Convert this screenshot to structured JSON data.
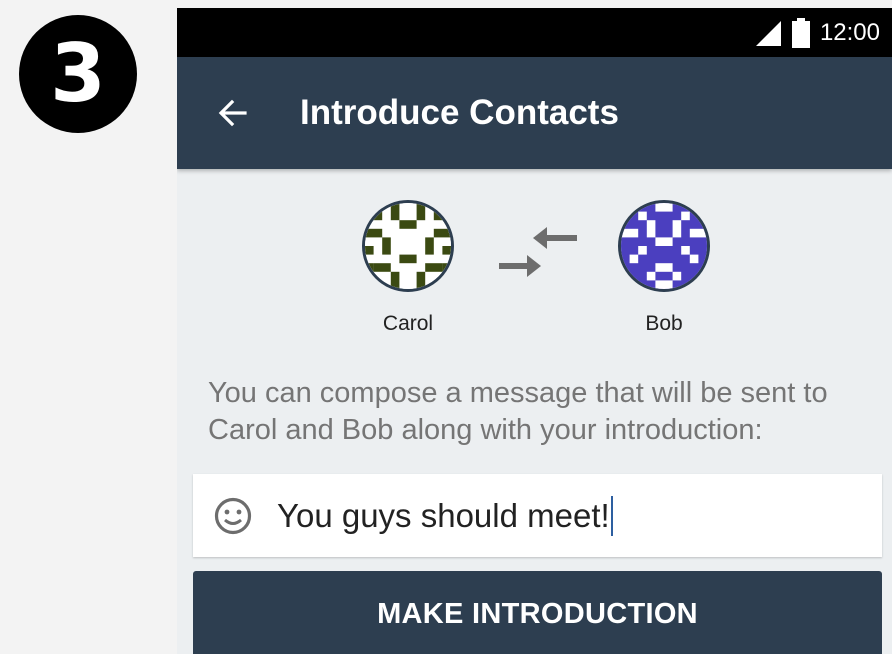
{
  "step": {
    "number": "3"
  },
  "statusbar": {
    "time": "12:00"
  },
  "appbar": {
    "title": "Introduce Contacts"
  },
  "contacts": {
    "first": {
      "name": "Carol"
    },
    "second": {
      "name": "Bob"
    }
  },
  "message": {
    "text": "You can compose a message that will be sent to Carol and Bob along with your introduction:"
  },
  "compose": {
    "value": "You guys should meet!"
  },
  "button": {
    "label": "MAKE INTRODUCTION"
  },
  "colors": {
    "appbar": "#2d3e50",
    "avatar_carol": "#3b4a12",
    "avatar_bob": "#4b3fbf",
    "cursor": "#2d5fa0"
  }
}
